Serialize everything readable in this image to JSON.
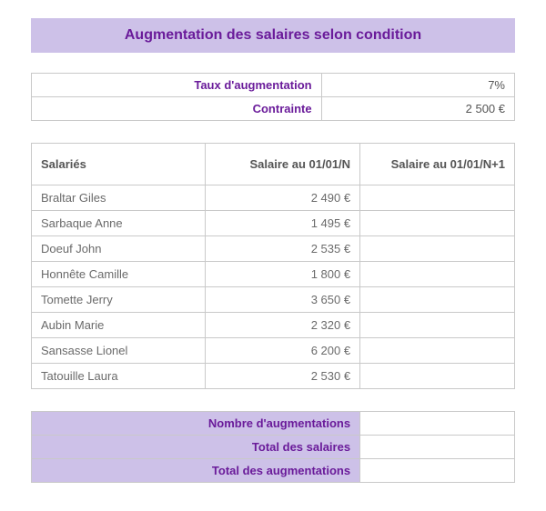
{
  "title": "Augmentation des salaires selon condition",
  "params": {
    "rate_label": "Taux d'augmentation",
    "rate_value": "7%",
    "constraint_label": "Contrainte",
    "constraint_value": "2 500 €"
  },
  "headers": {
    "employee": "Salariés",
    "salary_n": "Salaire au 01/01/N",
    "salary_n1": "Salaire au 01/01/N+1"
  },
  "employees": [
    {
      "name": "Braltar Giles",
      "salary_n": "2 490 €",
      "salary_n1": ""
    },
    {
      "name": "Sarbaque Anne",
      "salary_n": "1 495 €",
      "salary_n1": ""
    },
    {
      "name": "Doeuf John",
      "salary_n": "2 535 €",
      "salary_n1": ""
    },
    {
      "name": "Honnête Camille",
      "salary_n": "1 800 €",
      "salary_n1": ""
    },
    {
      "name": "Tomette Jerry",
      "salary_n": "3 650 €",
      "salary_n1": ""
    },
    {
      "name": "Aubin Marie",
      "salary_n": "2 320 €",
      "salary_n1": ""
    },
    {
      "name": "Sansasse Lionel",
      "salary_n": "6 200 €",
      "salary_n1": ""
    },
    {
      "name": "Tatouille Laura",
      "salary_n": "2 530 €",
      "salary_n1": ""
    }
  ],
  "summary": {
    "count_label": "Nombre d'augmentations",
    "count_value": "",
    "total_salaries_label": "Total des salaires",
    "total_salaries_value": "",
    "total_raises_label": "Total des augmentations",
    "total_raises_value": ""
  }
}
